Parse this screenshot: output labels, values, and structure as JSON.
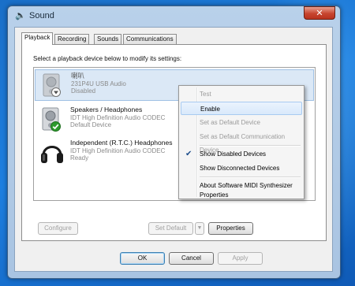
{
  "window": {
    "title": "Sound",
    "close_glyph": "✕"
  },
  "tabs": [
    {
      "label": "Playback",
      "active": true
    },
    {
      "label": "Recording"
    },
    {
      "label": "Sounds"
    },
    {
      "label": "Communications"
    }
  ],
  "instruction": "Select a playback device below to modify its settings:",
  "devices": [
    {
      "name": "喇叭",
      "line1": "231P4U USB Audio",
      "line2": "Disabled",
      "icon": "speaker-icon",
      "status_icon": "disabled-arrow-icon"
    },
    {
      "name": "Speakers / Headphones",
      "line1": "IDT High Definition Audio CODEC",
      "line2": "Default Device",
      "icon": "speaker-icon",
      "status_icon": "default-check-icon"
    },
    {
      "name": "Independent (R.T.C.) Headphones",
      "line1": "IDT High Definition Audio CODEC",
      "line2": "Ready",
      "icon": "headphones-icon"
    }
  ],
  "buttons": {
    "configure": "Configure",
    "set_default": "Set Default",
    "properties": "Properties",
    "ok": "OK",
    "cancel": "Cancel",
    "apply": "Apply"
  },
  "context_menu": {
    "items": [
      {
        "label": "Test",
        "disabled": true
      },
      {
        "label": "Enable",
        "hover": true
      },
      {
        "label": "Set as Default Device",
        "disabled": true
      },
      {
        "label": "Set as Default Communication Device",
        "disabled": true
      },
      {
        "label": "Show Disabled Devices",
        "checked": true
      },
      {
        "label": "Show Disconnected Devices"
      },
      {
        "label": "About Software MIDI Synthesizer"
      },
      {
        "label": "Properties"
      }
    ]
  },
  "colors": {
    "desktop": "#1d7fe0",
    "selection": "#dbe8f6",
    "default_check": "#2d9a2d"
  }
}
